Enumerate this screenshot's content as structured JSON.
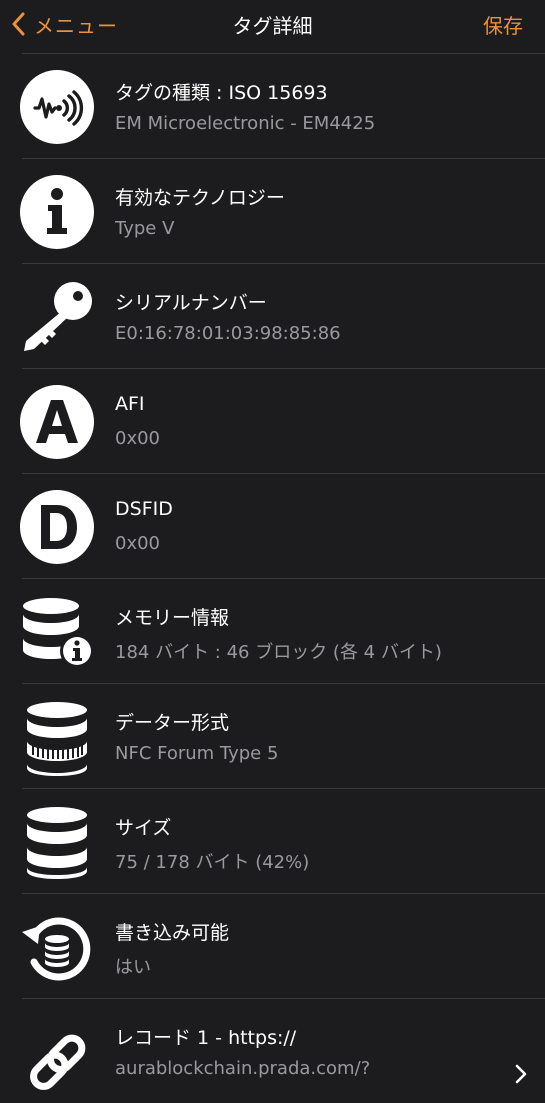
{
  "nav": {
    "back_label": "メニュー",
    "title": "タグ詳細",
    "save_label": "保存"
  },
  "colors": {
    "accent": "#e8923d",
    "background": "#1c1c1e",
    "separator": "#38383a",
    "secondary_text": "#9a9a9e"
  },
  "rows": [
    {
      "icon": "nfc-wave-icon",
      "title": "タグの種類 : ISO 15693",
      "value": "EM Microelectronic - EM4425"
    },
    {
      "icon": "info-icon",
      "title": "有効なテクノロジー",
      "value": "Type V"
    },
    {
      "icon": "key-icon",
      "title": "シリアルナンバー",
      "value": "E0:16:78:01:03:98:85:86"
    },
    {
      "icon": "letter-a-icon",
      "title": "AFI",
      "value": "0x00"
    },
    {
      "icon": "letter-d-icon",
      "title": "DSFID",
      "value": "0x00"
    },
    {
      "icon": "database-info-icon",
      "title": "メモリー情報",
      "value": "184 バイト : 46 ブロック (各 4 バイト)"
    },
    {
      "icon": "database-format-icon",
      "title": "データー形式",
      "value": "NFC Forum Type 5"
    },
    {
      "icon": "database-icon",
      "title": "サイズ",
      "value": "75 / 178 バイト (42%)"
    },
    {
      "icon": "refresh-database-icon",
      "title": "書き込み可能",
      "value": "はい"
    },
    {
      "icon": "link-icon",
      "title": "レコード 1 - https://",
      "value": "aurablockchain.prada.com/?"
    }
  ]
}
